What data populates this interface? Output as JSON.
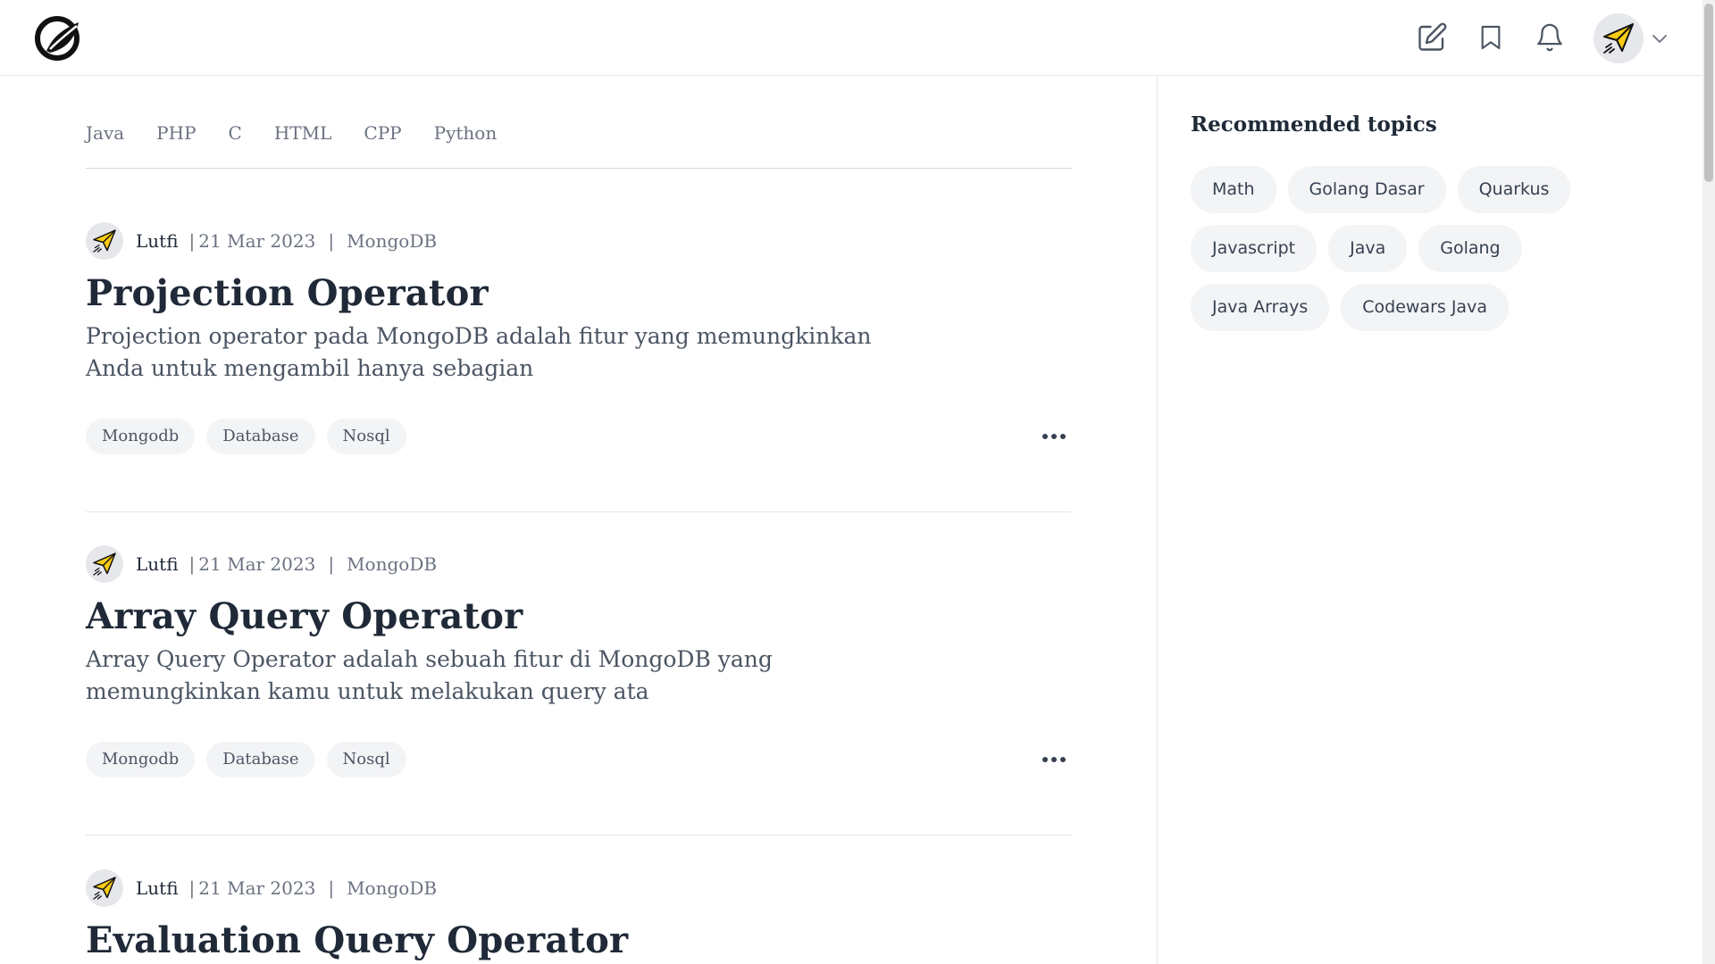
{
  "header": {
    "logo": "leaf-logo-icon",
    "icons": [
      "write-icon",
      "bookmark-icon",
      "bell-icon"
    ],
    "avatar": "paper-plane-avatar",
    "menu_icon": "chevron-down-icon"
  },
  "lang_tabs": [
    "Java",
    "PHP",
    "C",
    "HTML",
    "CPP",
    "Python"
  ],
  "articles": [
    {
      "author": "Lutfi",
      "date": "21 Mar 2023",
      "topic": "MongoDB",
      "title": "Projection Operator",
      "excerpt": "Projection operator pada MongoDB adalah fitur yang memungkinkan Anda untuk mengambil hanya sebagian",
      "tags": [
        "Mongodb",
        "Database",
        "Nosql"
      ]
    },
    {
      "author": "Lutfi",
      "date": "21 Mar 2023",
      "topic": "MongoDB",
      "title": "Array Query Operator",
      "excerpt": "Array Query Operator adalah sebuah fitur di MongoDB yang memungkinkan kamu untuk melakukan query ata",
      "tags": [
        "Mongodb",
        "Database",
        "Nosql"
      ]
    },
    {
      "author": "Lutfi",
      "date": "21 Mar 2023",
      "topic": "MongoDB",
      "title": "Evaluation Query Operator"
    }
  ],
  "meta_separator": "|",
  "sidebar": {
    "title": "Recommended topics",
    "topics": [
      "Math",
      "Golang Dasar",
      "Quarkus",
      "Javascript",
      "Java",
      "Golang",
      "Java Arrays",
      "Codewars Java"
    ]
  }
}
